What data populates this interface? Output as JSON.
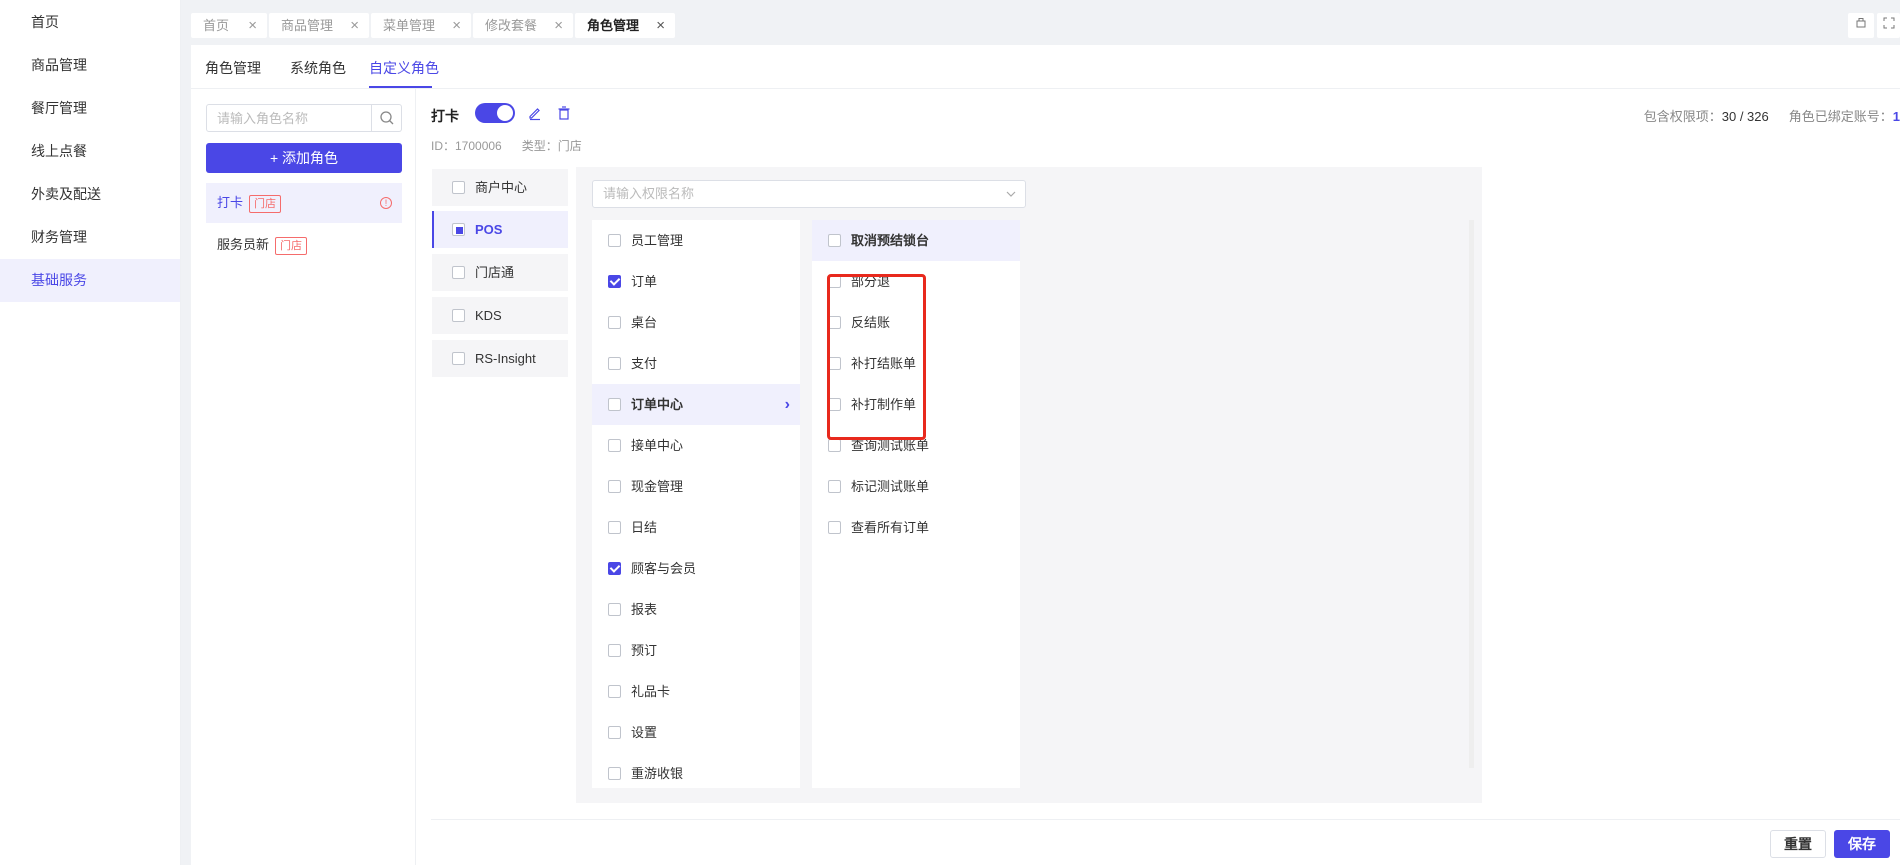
{
  "sidebar": {
    "items": [
      {
        "label": "首页"
      },
      {
        "label": "商品管理"
      },
      {
        "label": "餐厅管理"
      },
      {
        "label": "线上点餐"
      },
      {
        "label": "外卖及配送"
      },
      {
        "label": "财务管理"
      },
      {
        "label": "基础服务",
        "active": true
      }
    ]
  },
  "page_tabs": [
    {
      "label": "首页"
    },
    {
      "label": "商品管理"
    },
    {
      "label": "菜单管理"
    },
    {
      "label": "修改套餐"
    },
    {
      "label": "角色管理",
      "active": true
    }
  ],
  "page_tab_close": "×",
  "sub_tabs": [
    {
      "label": "角色管理"
    },
    {
      "label": "系统角色"
    },
    {
      "label": "自定义角色",
      "active": true
    }
  ],
  "role_panel": {
    "search_placeholder": "请输入角色名称",
    "add_button": "+ 添加角色",
    "roles": [
      {
        "name": "打卡",
        "badge": "门店",
        "active": true,
        "warn": "!"
      },
      {
        "name": "服务员新",
        "badge": "门店"
      }
    ]
  },
  "detail": {
    "title": "打卡",
    "id_text": "ID：1700006",
    "type_text": "类型：门店",
    "enabled": true,
    "stats_label1": "包含权限项：",
    "stats_value1": "30 / 326",
    "stats_label2": "角色已绑定账号：",
    "stats_value2": "1"
  },
  "modules": [
    {
      "label": "商户中心",
      "state": "unchecked"
    },
    {
      "label": "POS",
      "state": "partial",
      "active": true
    },
    {
      "label": "门店通",
      "state": "unchecked"
    },
    {
      "label": "KDS",
      "state": "unchecked"
    },
    {
      "label": "RS-Insight",
      "state": "unchecked"
    }
  ],
  "perm_search_placeholder": "请输入权限名称",
  "perm_col1": [
    {
      "label": "员工管理",
      "checked": false
    },
    {
      "label": "订单",
      "checked": true
    },
    {
      "label": "桌台",
      "checked": false
    },
    {
      "label": "支付",
      "checked": false
    },
    {
      "label": "订单中心",
      "checked": false,
      "active": true,
      "arrow": "›"
    },
    {
      "label": "接单中心",
      "checked": false
    },
    {
      "label": "现金管理",
      "checked": false
    },
    {
      "label": "日结",
      "checked": false
    },
    {
      "label": "顾客与会员",
      "checked": true
    },
    {
      "label": "报表",
      "checked": false
    },
    {
      "label": "预订",
      "checked": false
    },
    {
      "label": "礼品卡",
      "checked": false
    },
    {
      "label": "设置",
      "checked": false
    },
    {
      "label": "重游收银",
      "checked": false
    }
  ],
  "perm_col2": [
    {
      "label": "取消预结锁台",
      "checked": false,
      "head": true
    },
    {
      "label": "部分退",
      "checked": false
    },
    {
      "label": "反结账",
      "checked": false
    },
    {
      "label": "补打结账单",
      "checked": false
    },
    {
      "label": "补打制作单",
      "checked": false
    },
    {
      "label": "查询测试账单",
      "checked": false
    },
    {
      "label": "标记测试账单",
      "checked": false
    },
    {
      "label": "查看所有订单",
      "checked": false
    }
  ],
  "footer": {
    "reset": "重置",
    "save": "保存"
  },
  "colors": {
    "accent": "#4a47e6",
    "badge_red": "#f56c6c",
    "highlight_box": "#e8291d"
  }
}
